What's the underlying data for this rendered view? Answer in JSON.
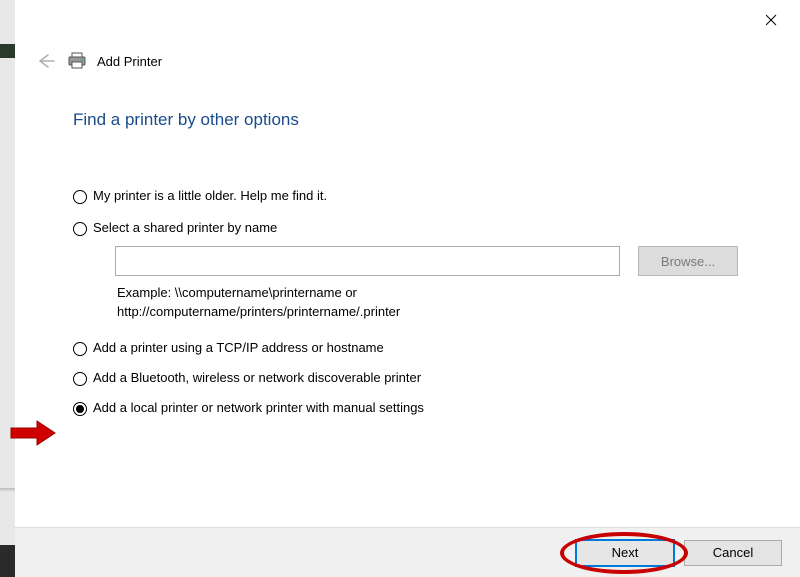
{
  "window": {
    "close_tooltip": "Close"
  },
  "header": {
    "back_tooltip": "Back",
    "title": "Add Printer"
  },
  "page": {
    "heading": "Find a printer by other options"
  },
  "options": {
    "older": "My printer is a little older. Help me find it.",
    "shared": "Select a shared printer by name",
    "shared_placeholder": "",
    "browse_label": "Browse...",
    "example_line1": "Example: \\\\computername\\printername or",
    "example_line2": "http://computername/printers/printername/.printer",
    "tcpip": "Add a printer using a TCP/IP address or hostname",
    "bluetooth": "Add a Bluetooth, wireless or network discoverable printer",
    "local": "Add a local printer or network printer with manual settings"
  },
  "footer": {
    "next": "Next",
    "cancel": "Cancel"
  }
}
